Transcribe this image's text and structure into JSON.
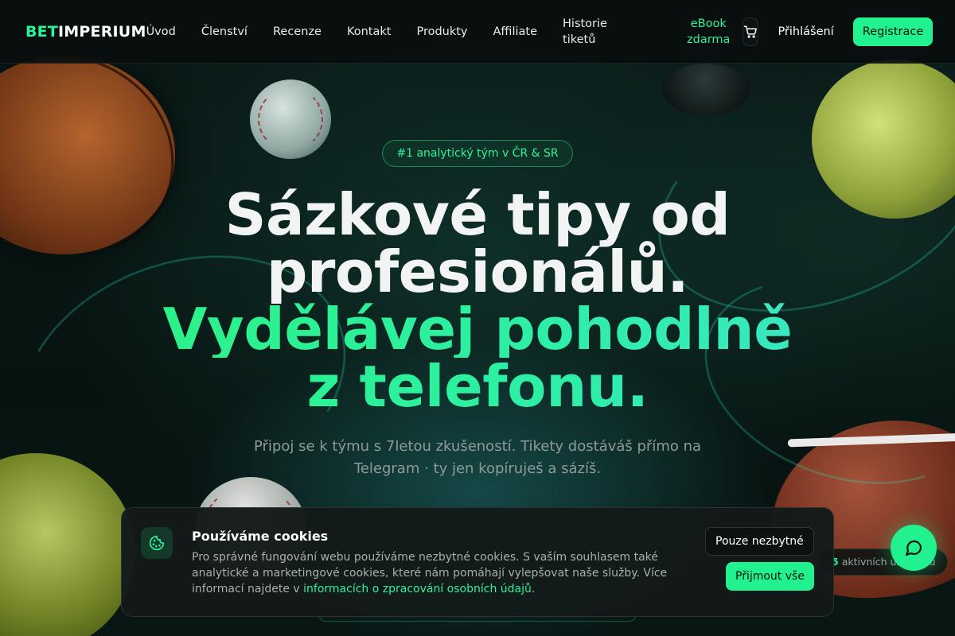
{
  "header": {
    "logo": {
      "part1": "BET",
      "part2": "IMPERIUM"
    },
    "nav": [
      {
        "label": "Úvod"
      },
      {
        "label": "Členství"
      },
      {
        "label": "Recenze"
      },
      {
        "label": "Kontakt"
      },
      {
        "label": "Produkty"
      },
      {
        "label": "Affiliate"
      },
      {
        "label": "Historie tiketů"
      }
    ],
    "ebook_label": "eBook zdarma",
    "cart_icon": "cart-icon",
    "login_label": "Přihlášení",
    "register_label": "Registrace"
  },
  "hero": {
    "badge": "#1 analytický tým v ČR & SR",
    "title_white": [
      "Sázkové tipy od",
      "profesionálů."
    ],
    "title_green": [
      "Vydělávej pohodlně",
      "z telefonu."
    ],
    "subtitle": "Připoj se k týmu s 7letou zkušeností. Tikety dostáváš přímo na Telegram · ty jen kopíruješ a sázíš."
  },
  "users_pill": {
    "count": "5",
    "label": "aktivních uživatelů"
  },
  "cookie": {
    "icon": "cookie-icon",
    "title": "Používáme cookies",
    "text_before": "Pro správné fungování webu používáme nezbytné cookies. S vaším souhlasem také analytické a marketingové cookies, které nám pomáhají vylepšovat naše služby. Více informací najdete v ",
    "link_text": "informacích o zpracování osobních údajů",
    "text_after": ".",
    "btn_necessary": "Pouze nezbytné",
    "btn_accept": "Přijmout vše"
  },
  "chat": {
    "icon": "chat-bubble-icon"
  },
  "colors": {
    "accent": "#22f18f",
    "accent_text": "#2cf29a",
    "header_bg": "#0a0e0e",
    "page_bg": "#061412"
  }
}
